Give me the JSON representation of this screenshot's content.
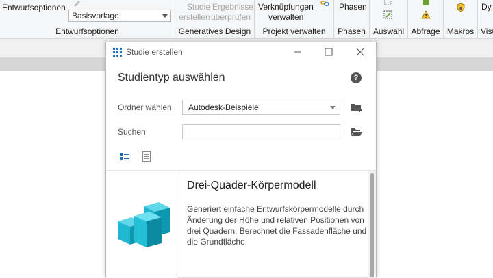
{
  "ribbon": {
    "groups": [
      {
        "label": "Entwurfsoptionen"
      },
      {
        "label": "Generatives Design"
      },
      {
        "label": "Projekt verwalten"
      },
      {
        "label": "Phasen"
      },
      {
        "label": "Auswahl"
      },
      {
        "label": "Abfrage"
      },
      {
        "label": "Makros"
      },
      {
        "label": "Visu"
      }
    ],
    "entwurfsoptionen_button": "Entwurfsoptionen",
    "basis_combo": "Basisvorlage",
    "studie_erstellen": [
      "Studie",
      "erstellen"
    ],
    "ergebnisse": [
      "Ergebnisse",
      "überprüfen"
    ],
    "verknuepfungen": [
      "Verknüpfungen",
      "verwalten"
    ],
    "phasen_button": "Phasen",
    "dynamo_label": "Dy"
  },
  "dialog": {
    "title": "Studie erstellen",
    "heading": "Studientyp auswählen",
    "folder_label": "Ordner wählen",
    "folder_value": "Autodesk-Beispiele",
    "search_label": "Suchen",
    "search_value": "",
    "help_glyph": "?",
    "study": {
      "name": "Drei-Quader-Körpermodell",
      "description": "Generiert einfache Entwurfskörpermodelle durch Änderung der Höhe und relativen Positionen von drei Quadern. Berechnet die Fassadenfläche und die Grundfläche."
    }
  },
  "colors": {
    "ribbon_bg": "#f5f6f7",
    "accent_blue": "#1f6fc5",
    "cube_cyan": "#1fb8d0"
  }
}
